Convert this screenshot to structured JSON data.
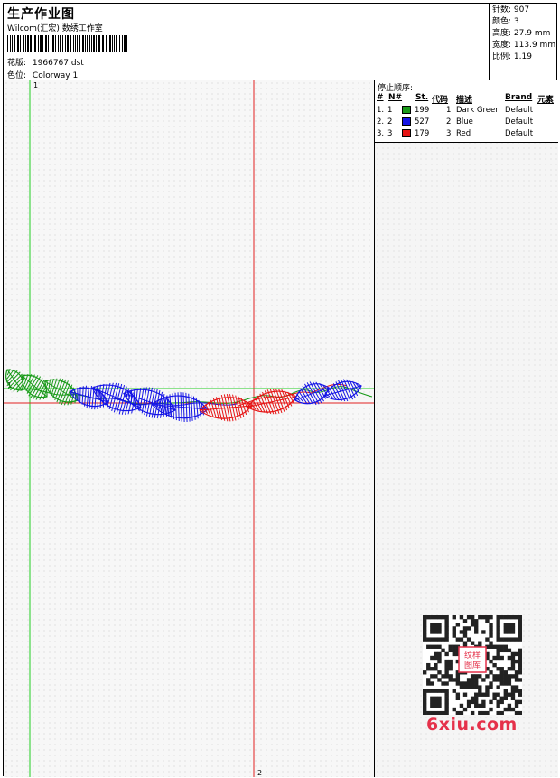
{
  "header": {
    "title": "生产作业图",
    "studio": "Wilcom(汇宏) 数绣工作室",
    "design_label": "花版:",
    "design_value": "1966767.dst",
    "colorway_label": "色位:",
    "colorway_value": "Colorway 1"
  },
  "stats": {
    "stitches_label": "针数:",
    "stitches_value": "907",
    "colors_label": "颜色:",
    "colors_value": "3",
    "height_label": "高度:",
    "height_value": "27.9 mm",
    "width_label": "宽度:",
    "width_value": "113.9 mm",
    "scale_label": "比例:",
    "scale_value": "1.19"
  },
  "stop_sequence": {
    "title": "停止顺序:",
    "headers": [
      "#",
      "N#",
      "St.",
      "代码",
      "描述",
      "Brand",
      "元素"
    ],
    "rows": [
      {
        "num": "1.",
        "n": "1",
        "st": "199",
        "code": "1",
        "desc": "Dark Green",
        "brand": "Default",
        "color": "#1a9a1a"
      },
      {
        "num": "2.",
        "n": "2",
        "st": "527",
        "code": "2",
        "desc": "Blue",
        "brand": "Default",
        "color": "#1414e6"
      },
      {
        "num": "3.",
        "n": "3",
        "st": "179",
        "code": "3",
        "desc": "Red",
        "brand": "Default",
        "color": "#e61414"
      }
    ]
  },
  "guides": {
    "v1_label": "1",
    "h1_label": "1",
    "v2_label": "2"
  },
  "watermark": {
    "site": "6xiu.com",
    "stamp": "纹样图库"
  }
}
